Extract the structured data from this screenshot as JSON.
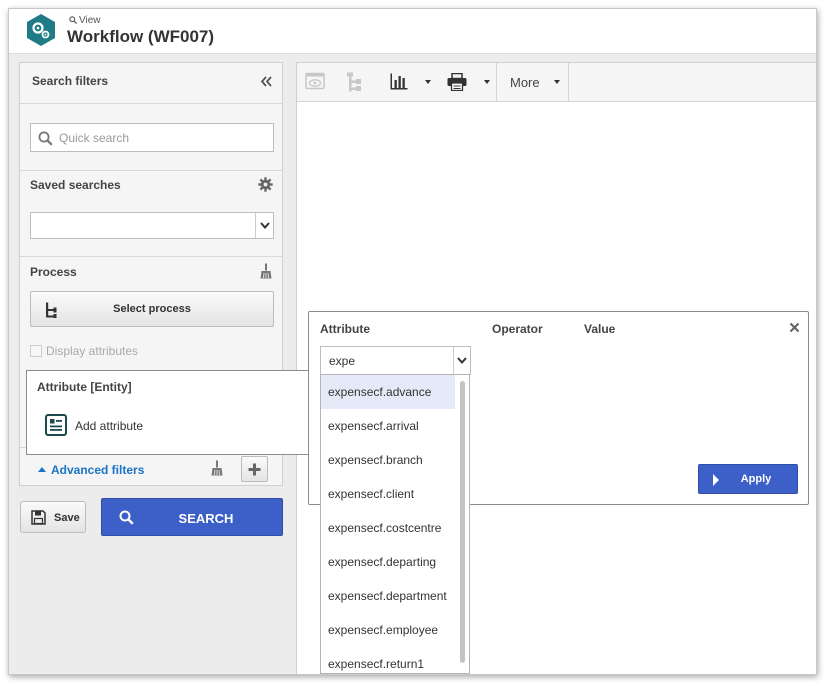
{
  "header": {
    "view_label": "View",
    "title": "Workflow (WF007)"
  },
  "colors": {
    "accent": "#3d5fc8",
    "link": "#1a73c6",
    "logo": "#1f7c86",
    "selected_row": "#e4eaf7"
  },
  "left_panel": {
    "search_filters": "Search filters",
    "quick_search_placeholder": "Quick search",
    "saved_searches": "Saved searches",
    "saved_search_value": "",
    "process": "Process",
    "select_process": "Select process",
    "display_attributes": "Display attributes",
    "advanced_filters": "Advanced filters",
    "save": "Save",
    "search": "SEARCH"
  },
  "toolbar": {
    "more": "More"
  },
  "attr_popup": {
    "heading": "Attribute [Entity]",
    "add_attribute": "Add attribute"
  },
  "filter_popup": {
    "col_attribute": "Attribute",
    "col_operator": "Operator",
    "col_value": "Value",
    "attribute_input": "expe",
    "apply": "Apply",
    "options": [
      "expensecf.advance",
      "expensecf.arrival",
      "expensecf.branch",
      "expensecf.client",
      "expensecf.costcentre",
      "expensecf.departing",
      "expensecf.department",
      "expensecf.employee",
      "expensecf.return1"
    ],
    "selected_option": "expensecf.advance"
  }
}
